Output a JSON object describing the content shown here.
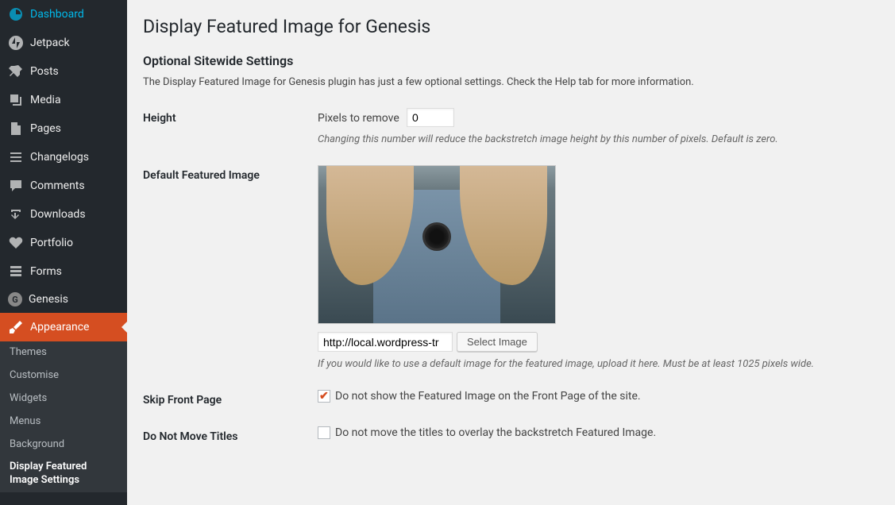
{
  "sidebar": {
    "items": [
      {
        "label": "Dashboard",
        "icon": "dashboard"
      },
      {
        "label": "Jetpack",
        "icon": "jetpack"
      },
      {
        "label": "Posts",
        "icon": "pin"
      },
      {
        "label": "Media",
        "icon": "media"
      },
      {
        "label": "Pages",
        "icon": "pages"
      },
      {
        "label": "Changelogs",
        "icon": "list"
      },
      {
        "label": "Comments",
        "icon": "comment"
      },
      {
        "label": "Downloads",
        "icon": "download"
      },
      {
        "label": "Portfolio",
        "icon": "heart"
      },
      {
        "label": "Forms",
        "icon": "forms"
      },
      {
        "label": "Genesis",
        "icon": "genesis"
      },
      {
        "label": "Appearance",
        "icon": "brush"
      }
    ],
    "submenu": [
      {
        "label": "Themes"
      },
      {
        "label": "Customise"
      },
      {
        "label": "Widgets"
      },
      {
        "label": "Menus"
      },
      {
        "label": "Background"
      },
      {
        "label": "Display Featured Image Settings"
      }
    ]
  },
  "page": {
    "title": "Display Featured Image for Genesis",
    "subtitle": "Optional Sitewide Settings",
    "intro": "The Display Featured Image for Genesis plugin has just a few optional settings. Check the Help tab for more information."
  },
  "fields": {
    "height": {
      "label": "Height",
      "inline": "Pixels to remove",
      "value": "0",
      "desc": "Changing this number will reduce the backstretch image height by this number of pixels. Default is zero."
    },
    "defaultImage": {
      "label": "Default Featured Image",
      "url": "http://local.wordpress-tr",
      "button": "Select Image",
      "desc": "If you would like to use a default image for the featured image, upload it here. Must be at least 1025 pixels wide."
    },
    "skipFront": {
      "label": "Skip Front Page",
      "checked": true,
      "text": "Do not show the Featured Image on the Front Page of the site."
    },
    "noMoveTitles": {
      "label": "Do Not Move Titles",
      "checked": false,
      "text": "Do not move the titles to overlay the backstretch Featured Image."
    }
  }
}
